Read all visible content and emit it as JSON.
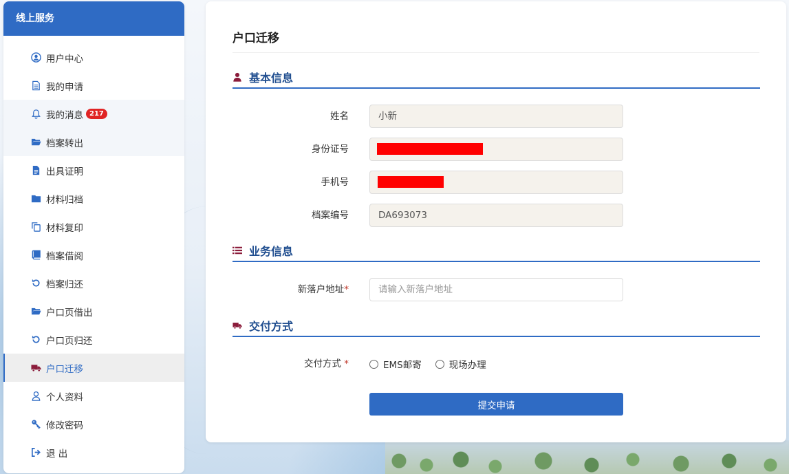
{
  "sidebar": {
    "title": "线上服务",
    "items": [
      {
        "label": "用户中心",
        "icon": "user-circle-icon"
      },
      {
        "label": "我的申请",
        "icon": "document-icon"
      },
      {
        "label": "我的消息",
        "icon": "bell-icon",
        "badge": "217"
      },
      {
        "label": "档案转出",
        "icon": "folder-open-icon"
      },
      {
        "label": "出具证明",
        "icon": "file-text-icon"
      },
      {
        "label": "材料归档",
        "icon": "folder-icon"
      },
      {
        "label": "材料复印",
        "icon": "copy-icon"
      },
      {
        "label": "档案借阅",
        "icon": "book-icon"
      },
      {
        "label": "档案归还",
        "icon": "undo-icon"
      },
      {
        "label": "户口页借出",
        "icon": "folder-open-icon"
      },
      {
        "label": "户口页归还",
        "icon": "undo-icon"
      },
      {
        "label": "户口迁移",
        "icon": "truck-icon"
      },
      {
        "label": "个人资料",
        "icon": "user-icon"
      },
      {
        "label": "修改密码",
        "icon": "key-icon"
      },
      {
        "label": "退 出",
        "icon": "sign-out-icon"
      }
    ],
    "active_index": 11
  },
  "main": {
    "title": "户口迁移",
    "basic": {
      "title": "基本信息",
      "name_label": "姓名",
      "name_value": "小新",
      "id_label": "身份证号",
      "phone_label": "手机号",
      "archive_label": "档案编号",
      "archive_value": "DA693073"
    },
    "business": {
      "title": "业务信息",
      "address_label": "新落户地址",
      "address_placeholder": "请输入新落户地址",
      "required_mark": "*"
    },
    "delivery": {
      "title": "交付方式",
      "method_label": "交付方式 ",
      "required_mark": "*",
      "options": [
        "EMS邮寄",
        "现场办理"
      ]
    },
    "submit_label": "提交申请"
  },
  "colors": {
    "primary": "#2f6bc4",
    "section_icon": "#8b1c3b",
    "badge": "#e02424",
    "redaction": "#ff0000"
  }
}
